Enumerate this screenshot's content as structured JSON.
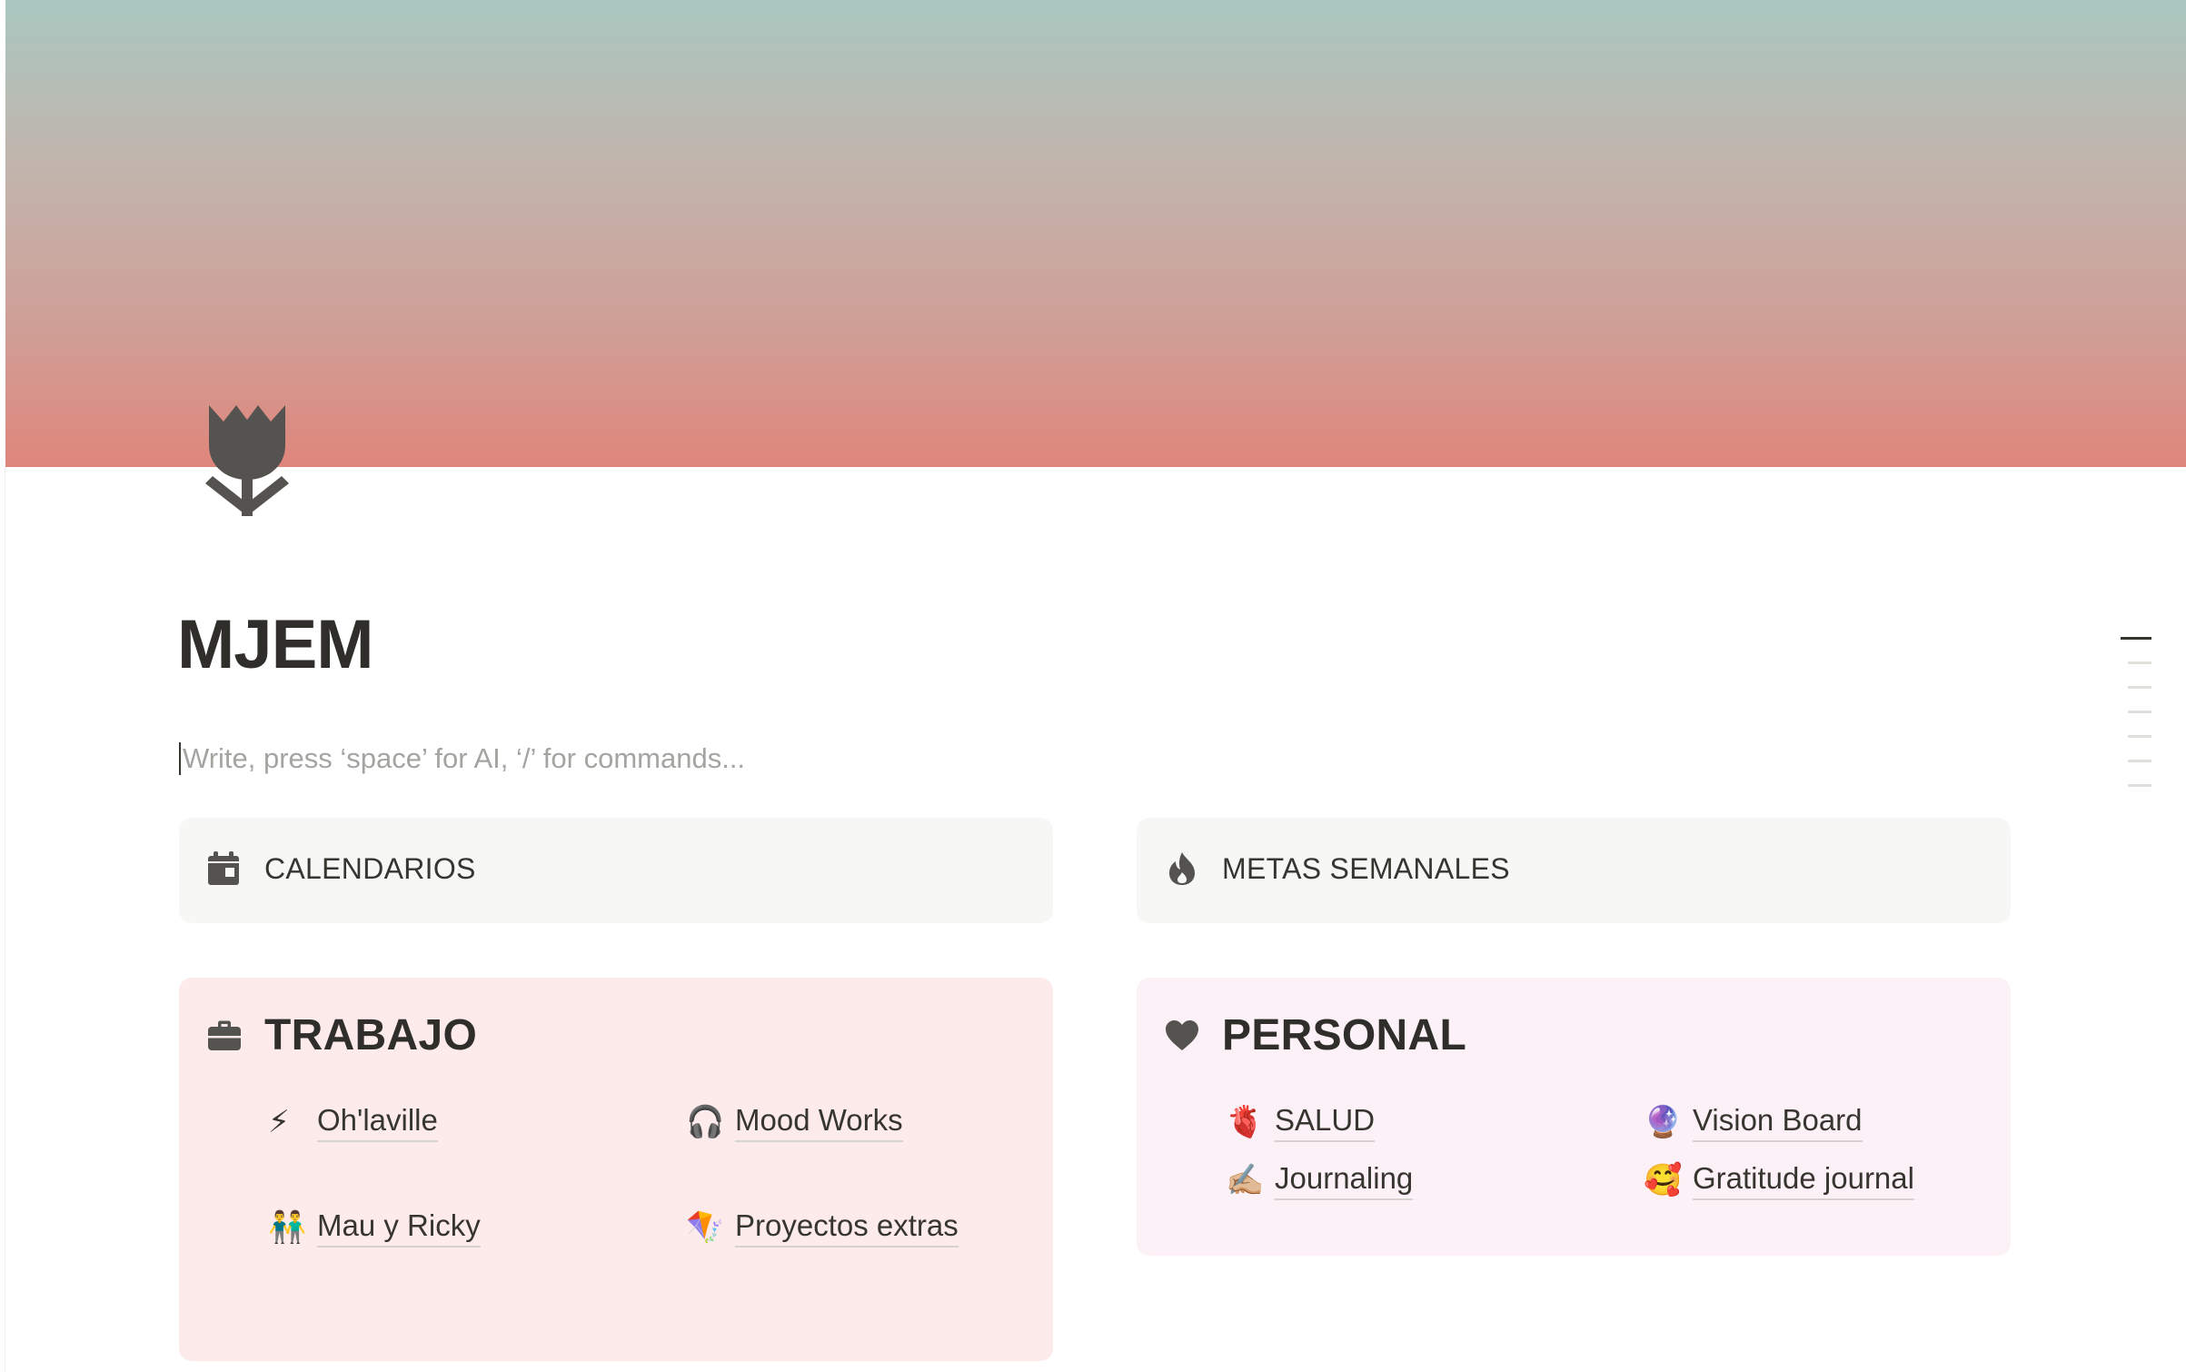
{
  "page": {
    "title": "MJEM",
    "placeholder": "Write, press ‘space’ for AI, ‘/’ for commands..."
  },
  "callouts": {
    "calendarios": {
      "label": "CALENDARIOS",
      "icon": "calendar-icon"
    },
    "metas": {
      "label": "METAS SEMANALES",
      "icon": "flame-icon"
    },
    "trabajo": {
      "label": "TRABAJO",
      "icon": "briefcase-icon",
      "links": [
        {
          "emoji": "⚡",
          "label": "Oh'laville"
        },
        {
          "emoji": "🎧",
          "label": "Mood Works"
        },
        {
          "emoji": "👬",
          "label": "Mau y Ricky"
        },
        {
          "emoji": "🪁",
          "label": "Proyectos extras"
        }
      ]
    },
    "personal": {
      "label": "PERSONAL",
      "icon": "heart-icon",
      "links": [
        {
          "emoji": "🫀",
          "label": "SALUD"
        },
        {
          "emoji": "🔮",
          "label": "Vision Board"
        },
        {
          "emoji": "✍🏼",
          "label": "Journaling"
        },
        {
          "emoji": "🥰",
          "label": "Gratitude journal"
        }
      ]
    }
  },
  "colors": {
    "cover_top": "#a9c7bf",
    "cover_bottom": "#df867b",
    "callout_gray": "#f7f7f5",
    "callout_pink": "#fdebec",
    "callout_lightpink": "#fcf1f6"
  }
}
